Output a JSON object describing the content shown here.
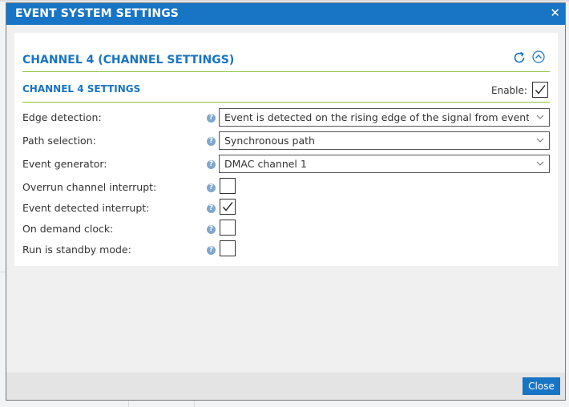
{
  "dialog": {
    "title": "EVENT SYSTEM SETTINGS",
    "close_symbol": "✕",
    "close_button_label": "Close"
  },
  "section": {
    "title": "CHANNEL 4 (CHANNEL SETTINGS)",
    "refresh_icon": "refresh-icon",
    "collapse_icon": "collapse-up-icon"
  },
  "subsection": {
    "title": "CHANNEL 4 SETTINGS",
    "enable_label": "Enable:",
    "enable_checked": true
  },
  "help_glyph": "?",
  "fields": {
    "edge_detection": {
      "label": "Edge detection:",
      "value": "Event is detected on the rising edge of the signal from event generator"
    },
    "path_selection": {
      "label": "Path selection:",
      "value": "Synchronous path"
    },
    "event_generator": {
      "label": "Event generator:",
      "value": "DMAC channel 1"
    },
    "overrun_interrupt": {
      "label": "Overrun channel interrupt:",
      "checked": false
    },
    "event_detected_interrupt": {
      "label": "Event detected interrupt:",
      "checked": true
    },
    "on_demand_clock": {
      "label": "On demand clock:",
      "checked": false
    },
    "run_standby": {
      "label": "Run is standby mode:",
      "checked": false
    }
  },
  "colors": {
    "accent": "#1874c4",
    "divider": "#8dc63f",
    "help": "#7fa7cf"
  }
}
